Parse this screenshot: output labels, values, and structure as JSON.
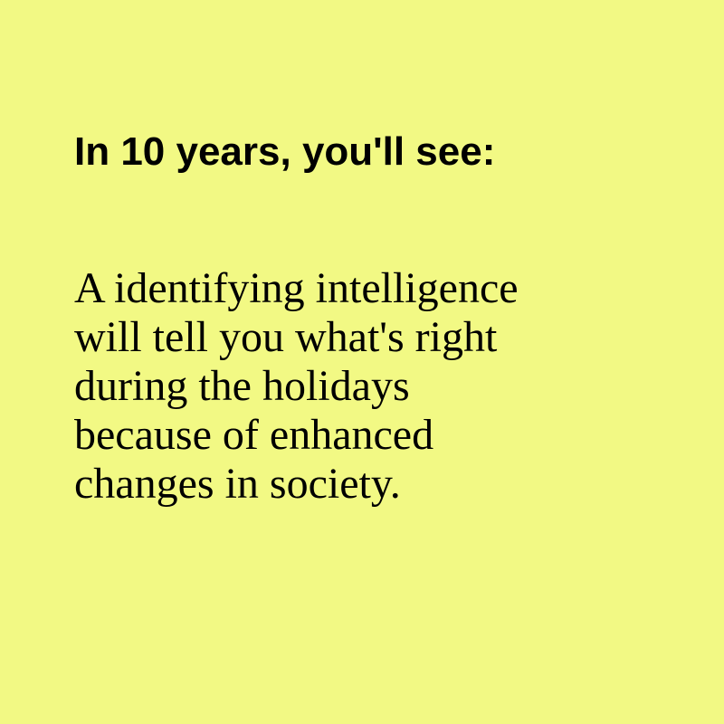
{
  "colors": {
    "background": "#f2f984",
    "text": "#000000"
  },
  "headline": "In 10 years, you'll see:",
  "body_lines": [
    "A identifying intelligence",
    "will tell you what's right",
    "during the holidays",
    "because of enhanced",
    "changes in society."
  ]
}
